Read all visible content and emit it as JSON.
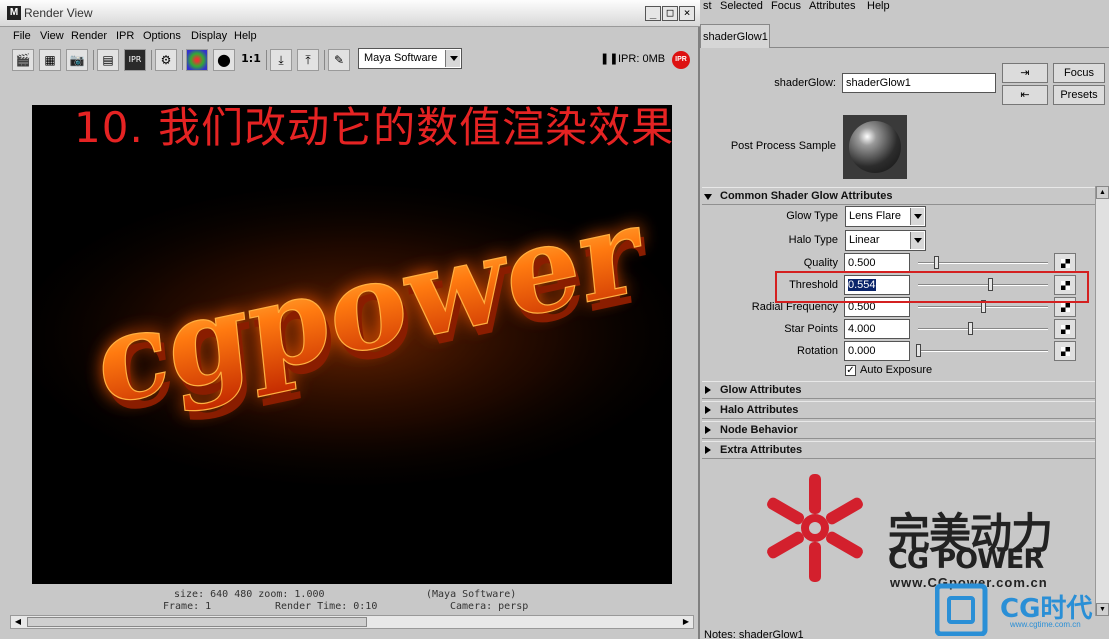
{
  "render_view": {
    "title": "Render View",
    "menu": [
      "File",
      "View",
      "Render",
      "IPR",
      "Options",
      "Display",
      "Help"
    ],
    "toolbar": {
      "ratio_label": "1:1",
      "renderer": "Maya Software",
      "ipr_status": "IPR: 0MB",
      "ipr_badge": "IPR"
    },
    "status": {
      "size": "size:  640  480 zoom: 1.000",
      "renderer": "(Maya Software)",
      "frame": "Frame: 1",
      "render_time": "Render Time: 0:10",
      "camera": "Camera: persp"
    },
    "render_image_text": "cgpower",
    "overlay_caption": "10. 我们改动它的数值渲染效果"
  },
  "attribute_editor": {
    "menu": [
      "st",
      "Selected",
      "Focus",
      "Attributes",
      "Help"
    ],
    "tab_label": "shaderGlow1",
    "node_type_label": "shaderGlow:",
    "node_name": "shaderGlow1",
    "focus_button": "Focus",
    "presets_button": "Presets",
    "swatch_label": "Post Process Sample",
    "sections": {
      "common": "Common Shader Glow Attributes",
      "glow": "Glow Attributes",
      "halo": "Halo Attributes",
      "node": "Node Behavior",
      "extra": "Extra Attributes"
    },
    "glow_type": {
      "label": "Glow Type",
      "value": "Lens Flare"
    },
    "halo_type": {
      "label": "Halo Type",
      "value": "Linear"
    },
    "quality": {
      "label": "Quality",
      "value": "0.500",
      "level": 0.14
    },
    "threshold": {
      "label": "Threshold",
      "value": "0.554",
      "level": 0.554
    },
    "radial_frequency": {
      "label": "Radial Frequency",
      "value": "0.500",
      "level": 0.5
    },
    "star_points": {
      "label": "Star Points",
      "value": "4.000",
      "level": 0.4
    },
    "rotation": {
      "label": "Rotation",
      "value": "0.000",
      "level": 0.0
    },
    "auto_exposure": {
      "label": "Auto Exposure",
      "checked": true
    },
    "notes_label": "Notes: shaderGlow1"
  },
  "watermark": {
    "cn_name": "完美动力",
    "en_name": "CG POWER",
    "url": "www.CGpower.com.cn",
    "cgtime_name": "CG时代",
    "cgtime_url": "www.cgtime.com.cn"
  },
  "colors": {
    "highlight": "#d42020",
    "caption": "#e52323",
    "glow": "#ff6a00"
  }
}
